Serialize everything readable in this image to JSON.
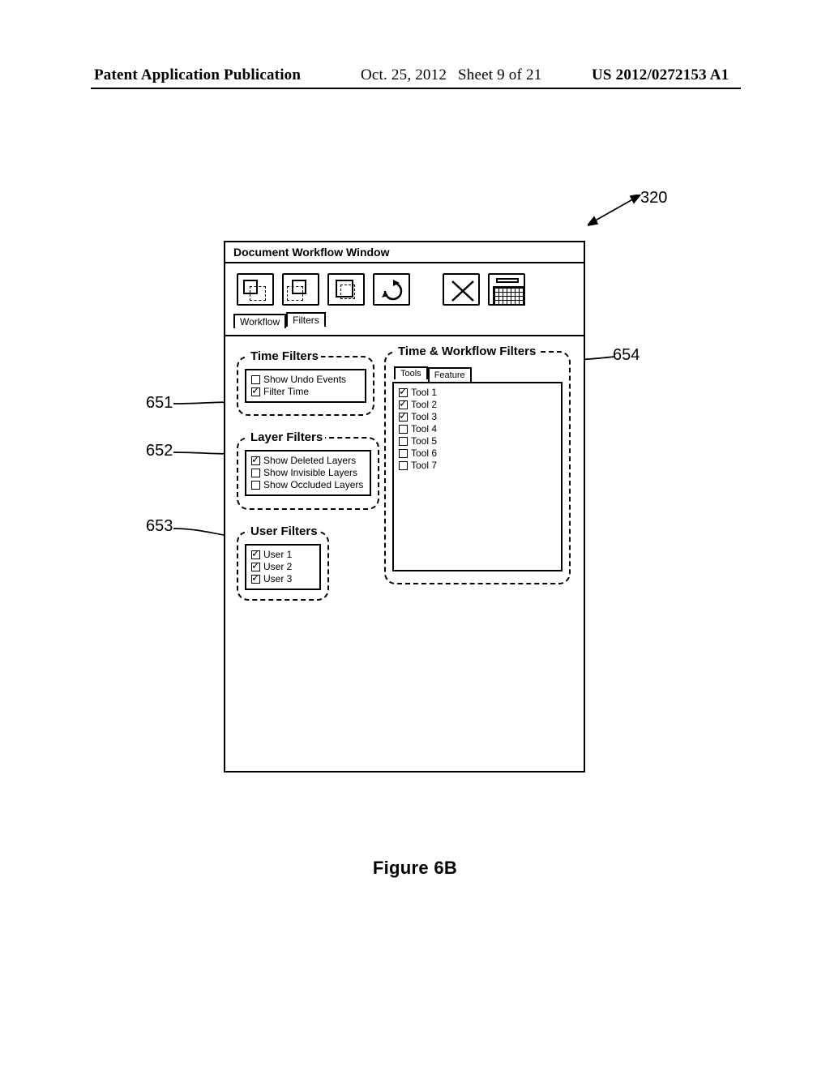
{
  "header": {
    "publication": "Patent Application Publication",
    "date": "Oct. 25, 2012",
    "sheet": "Sheet 9 of 21",
    "docnum": "US 2012/0272153 A1"
  },
  "figure_caption": "Figure 6B",
  "callouts": {
    "ref320": "320",
    "ref651": "651",
    "ref652": "652",
    "ref653": "653",
    "ref654": "654"
  },
  "window": {
    "title": "Document Workflow Window",
    "tabs": {
      "workflow": "Workflow",
      "filters": "Filters"
    }
  },
  "time_filters": {
    "title": "Time Filters",
    "items": [
      {
        "label": "Show Undo Events",
        "checked": false
      },
      {
        "label": "Filter Time",
        "checked": true
      }
    ]
  },
  "layer_filters": {
    "title": "Layer Filters",
    "items": [
      {
        "label": "Show Deleted Layers",
        "checked": true
      },
      {
        "label": "Show Invisible Layers",
        "checked": false
      },
      {
        "label": "Show Occluded Layers",
        "checked": false
      }
    ]
  },
  "user_filters": {
    "title": "User Filters",
    "items": [
      {
        "label": "User 1",
        "checked": true
      },
      {
        "label": "User 2",
        "checked": true
      },
      {
        "label": "User 3",
        "checked": true
      }
    ]
  },
  "twf_filters": {
    "title": "Time & Workflow Filters",
    "tabs": {
      "tools": "Tools",
      "feature": "Feature"
    },
    "items": [
      {
        "label": "Tool 1",
        "checked": true
      },
      {
        "label": "Tool 2",
        "checked": true
      },
      {
        "label": "Tool 3",
        "checked": true
      },
      {
        "label": "Tool 4",
        "checked": false
      },
      {
        "label": "Tool 5",
        "checked": false
      },
      {
        "label": "Tool 6",
        "checked": false
      },
      {
        "label": "Tool 7",
        "checked": false
      }
    ]
  }
}
